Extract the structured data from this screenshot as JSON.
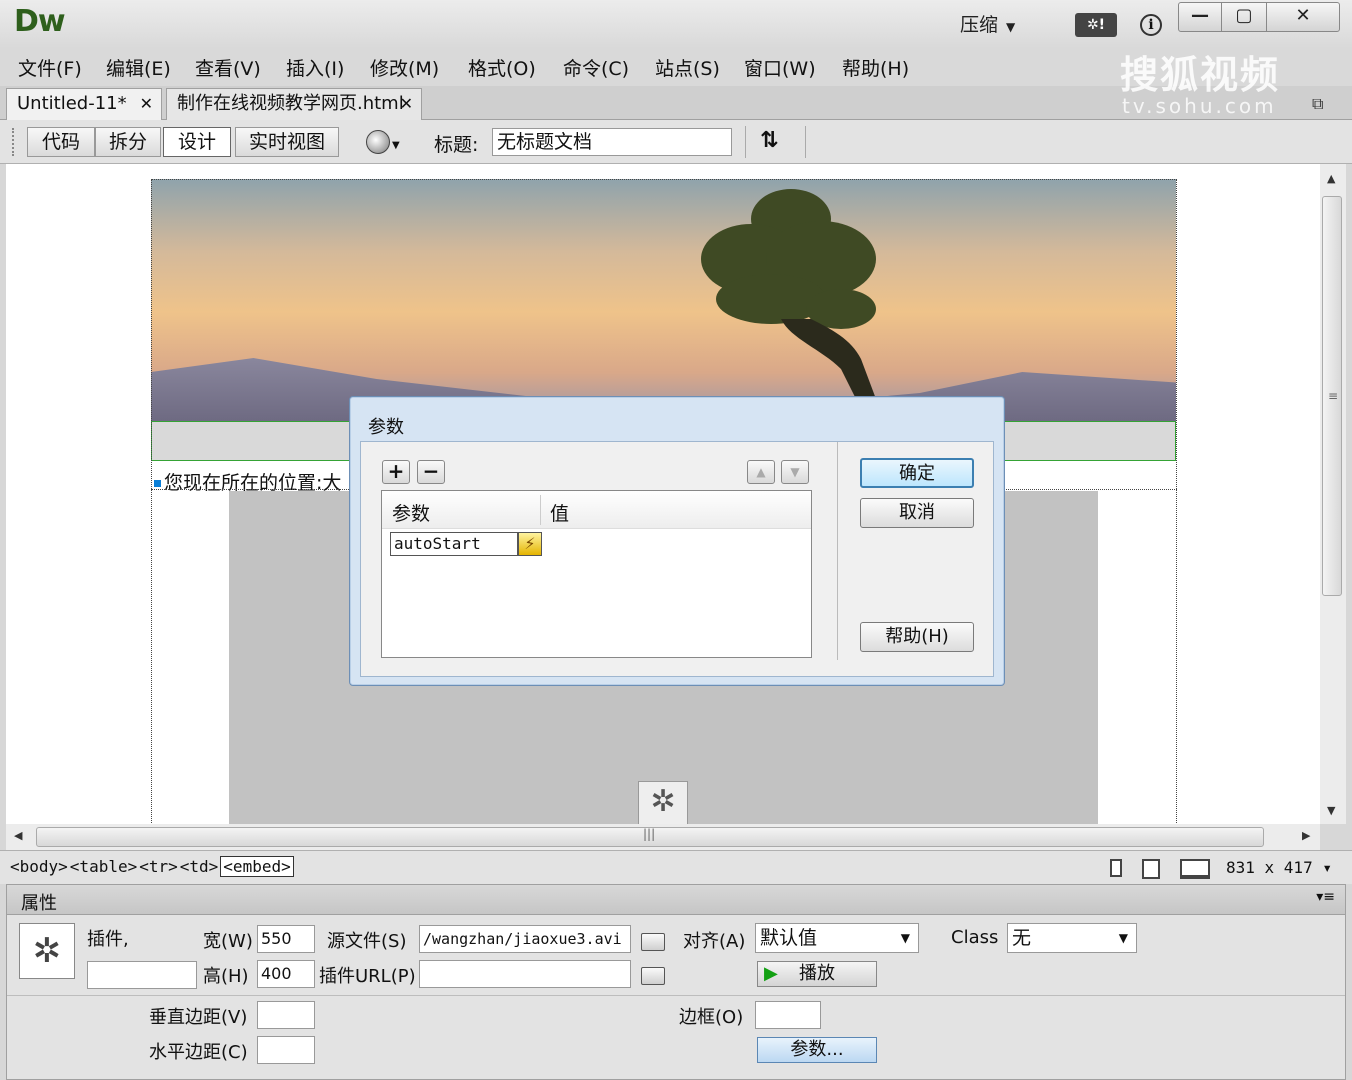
{
  "app": {
    "logo": "Dw",
    "compress_label": "压缩",
    "ext_button": "✲!",
    "info": "i",
    "win_min": "—",
    "win_max": "▢",
    "win_close": "✕"
  },
  "watermark": {
    "main": "搜狐视频",
    "sub": "tv.sohu.com"
  },
  "menu": [
    "文件(F)",
    "编辑(E)",
    "查看(V)",
    "插入(I)",
    "修改(M)",
    "格式(O)",
    "命令(C)",
    "站点(S)",
    "窗口(W)",
    "帮助(H)"
  ],
  "tabs": [
    {
      "label": "Untitled-11*",
      "close": "✕"
    },
    {
      "label": "制作在线视频教学网页.html",
      "close": "✕"
    }
  ],
  "toolbar": {
    "code": "代码",
    "split": "拆分",
    "design": "设计",
    "live": "实时视图",
    "title_label": "标题:",
    "title_value": "无标题文档",
    "sync": "⇅"
  },
  "page": {
    "location_text": "您现在所在的位置:大"
  },
  "dialog": {
    "title": "参数",
    "add": "+",
    "remove": "−",
    "up": "▲",
    "down": "▼",
    "col_param": "参数",
    "col_value": "值",
    "param_input_value": "autoStart",
    "bolt": "⚡",
    "ok": "确定",
    "cancel": "取消",
    "help": "帮助(H)"
  },
  "statusbar": {
    "tags": [
      "<body>",
      "<table>",
      "<tr>",
      "<td>"
    ],
    "selected_tag": "<embed>",
    "size": "831 x 417 ▾"
  },
  "properties": {
    "title": "属性",
    "menu_icon": "▾≡",
    "type_label": "插件,",
    "name_value": "",
    "width_label": "宽(W)",
    "width_value": "550",
    "height_label": "高(H)",
    "height_value": "400",
    "src_label": "源文件(S)",
    "src_value": "/wangzhan/jiaoxue3.avi",
    "plugin_url_label": "插件URL(P)",
    "plugin_url_value": "",
    "align_label": "对齐(A)",
    "align_value": "默认值",
    "class_label": "Class",
    "class_value": "无",
    "play_label": "播放",
    "vspace_label": "垂直边距(V)",
    "vspace_value": "",
    "hspace_label": "水平边距(C)",
    "hspace_value": "",
    "border_label": "边框(O)",
    "border_value": "",
    "params_button": "参数..."
  }
}
